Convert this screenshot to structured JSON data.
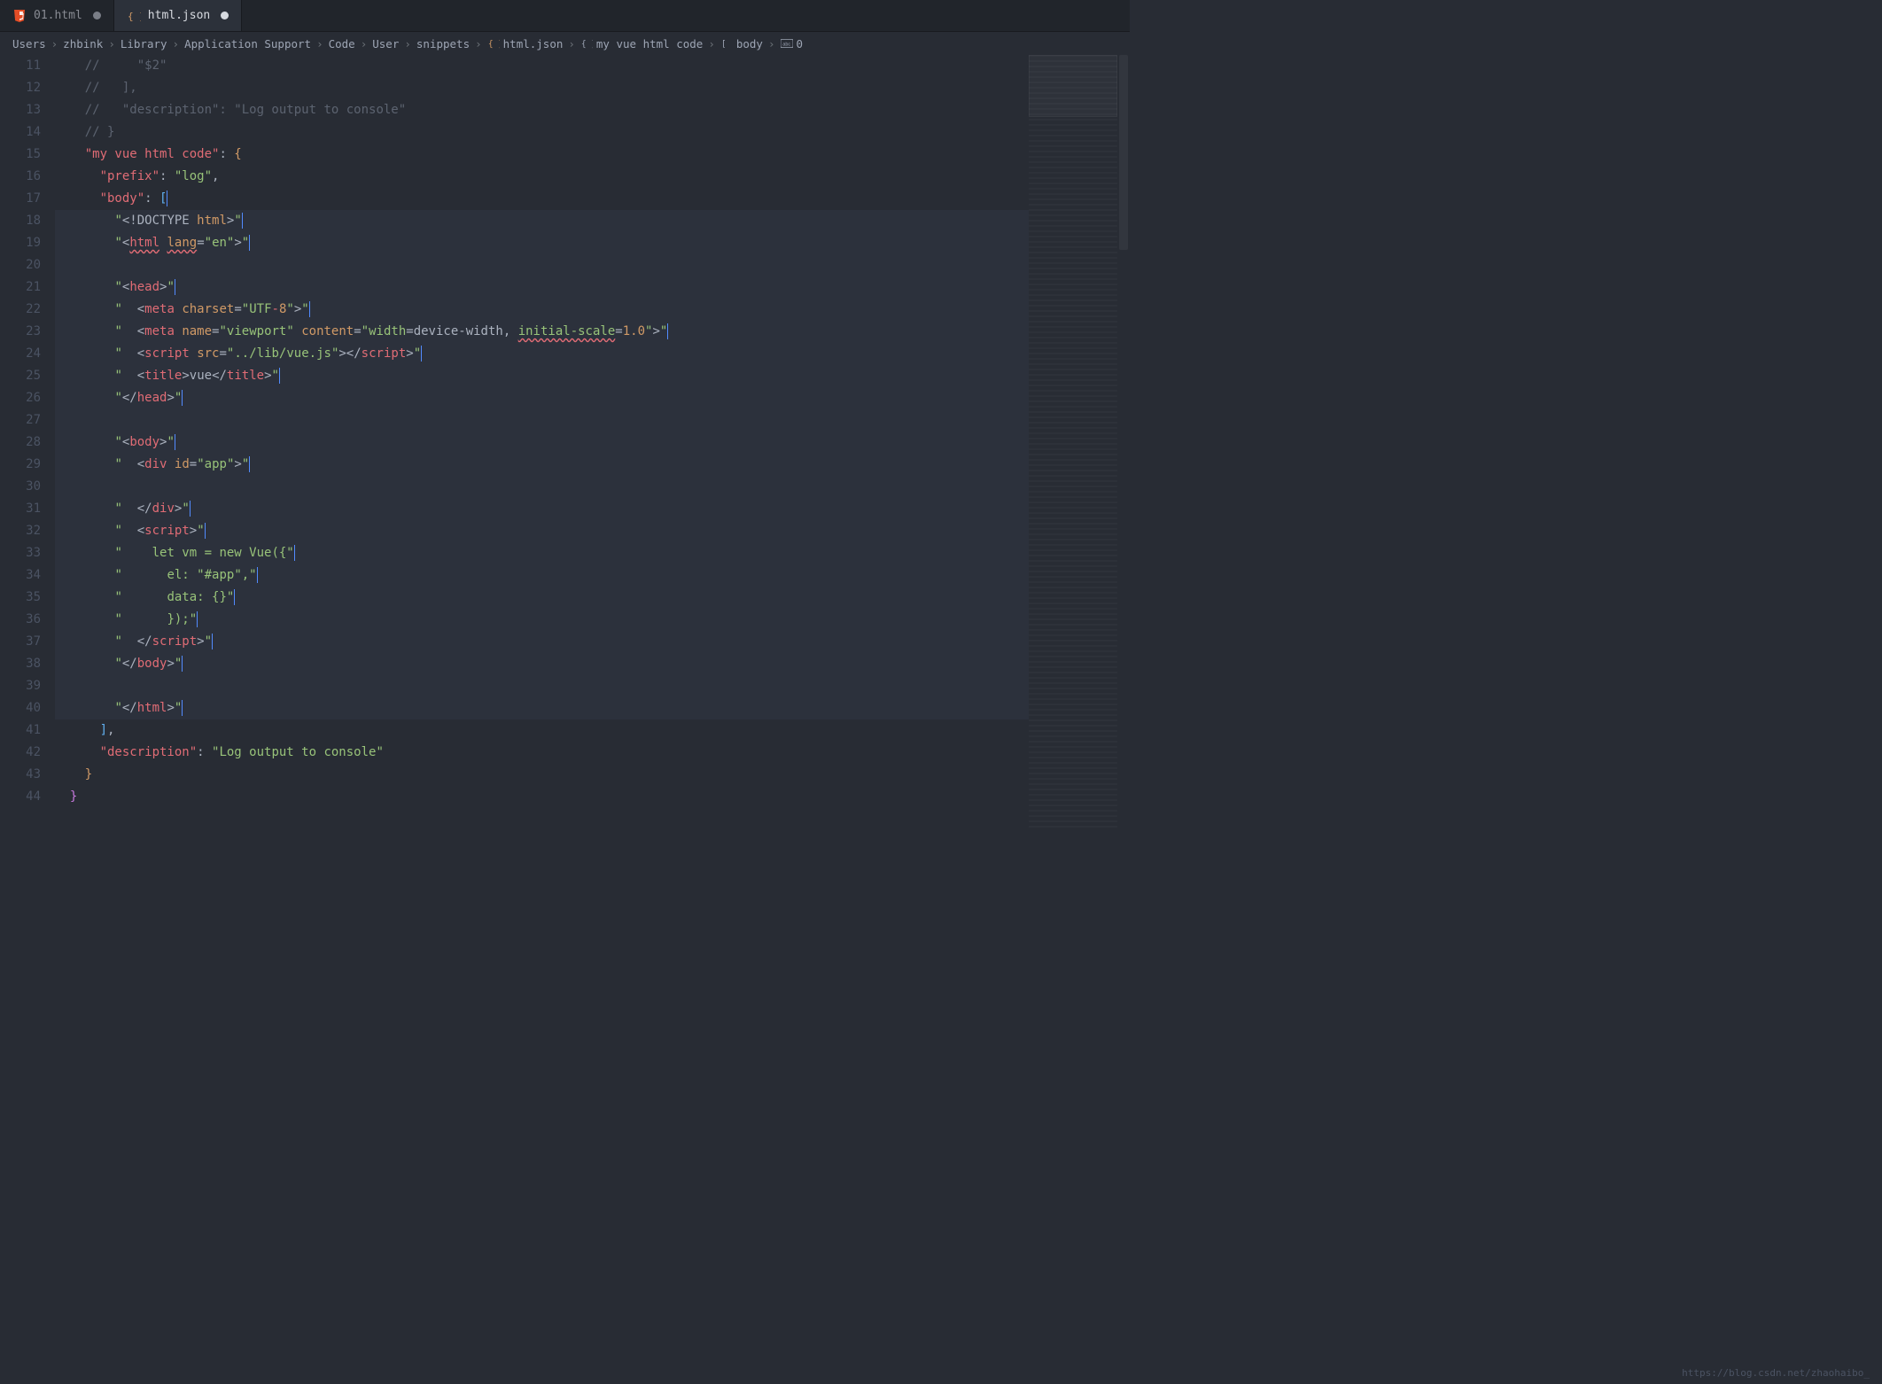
{
  "tabs": [
    {
      "label": "01.html",
      "icon": "html5-icon",
      "dirty": true,
      "active": false
    },
    {
      "label": "html.json",
      "icon": "json-icon",
      "dirty": true,
      "active": true
    }
  ],
  "breadcrumb": [
    {
      "label": "Users"
    },
    {
      "label": "zhbink"
    },
    {
      "label": "Library"
    },
    {
      "label": "Application Support"
    },
    {
      "label": "Code"
    },
    {
      "label": "User"
    },
    {
      "label": "snippets"
    },
    {
      "label": "html.json",
      "icon": "json-icon"
    },
    {
      "label": "my vue html code",
      "icon": "braces-icon"
    },
    {
      "label": "body",
      "icon": "brackets-icon"
    },
    {
      "label": "0",
      "icon": "abc-icon"
    }
  ],
  "line_start": 11,
  "lines": [
    {
      "n": 11,
      "hl": false,
      "tokens": [
        {
          "cls": "c-comment",
          "t": "//     \"$2\""
        }
      ],
      "indent": 2
    },
    {
      "n": 12,
      "hl": false,
      "tokens": [
        {
          "cls": "c-comment",
          "t": "//   ],"
        }
      ],
      "indent": 2
    },
    {
      "n": 13,
      "hl": false,
      "tokens": [
        {
          "cls": "c-comment",
          "t": "//   \"description\": \"Log output to console\""
        }
      ],
      "indent": 2
    },
    {
      "n": 14,
      "hl": false,
      "tokens": [
        {
          "cls": "c-comment",
          "t": "// }"
        }
      ],
      "indent": 2
    },
    {
      "n": 15,
      "hl": false,
      "tokens": [
        {
          "cls": "c-key",
          "t": "\"my vue html code\""
        },
        {
          "cls": "c-punct",
          "t": ": "
        },
        {
          "cls": "c-brace",
          "t": "{"
        }
      ],
      "indent": 2
    },
    {
      "n": 16,
      "hl": false,
      "tokens": [
        {
          "cls": "c-key",
          "t": "\"prefix\""
        },
        {
          "cls": "c-punct",
          "t": ": "
        },
        {
          "cls": "c-string",
          "t": "\"log\""
        },
        {
          "cls": "c-punct",
          "t": ","
        }
      ],
      "indent": 3
    },
    {
      "n": 17,
      "hl": false,
      "tokens": [
        {
          "cls": "c-key",
          "t": "\"body\""
        },
        {
          "cls": "c-punct",
          "t": ": "
        },
        {
          "cls": "c-bracket",
          "t": "["
        }
      ],
      "indent": 3,
      "cursor_after": true
    },
    {
      "n": 18,
      "hl": true,
      "tokens": [
        {
          "cls": "c-string",
          "t": "\""
        },
        {
          "cls": "c-tagpunc",
          "t": "<!DOCTYPE "
        },
        {
          "cls": "c-attr",
          "t": "html"
        },
        {
          "cls": "c-tagpunc",
          "t": ">"
        },
        {
          "cls": "c-string",
          "t": "\""
        }
      ],
      "indent": 4,
      "caret": true
    },
    {
      "n": 19,
      "hl": true,
      "tokens": [
        {
          "cls": "c-string",
          "t": "\""
        },
        {
          "cls": "c-tagpunc",
          "t": "<"
        },
        {
          "cls": "c-tagname squiggle",
          "t": "html"
        },
        {
          "cls": "c-inner",
          "t": " "
        },
        {
          "cls": "c-attr squiggle",
          "t": "lang"
        },
        {
          "cls": "c-tagpunc",
          "t": "="
        },
        {
          "cls": "c-string",
          "t": "\""
        },
        {
          "cls": "c-attrval",
          "t": "en"
        },
        {
          "cls": "c-string",
          "t": "\""
        },
        {
          "cls": "c-tagpunc",
          "t": ">"
        },
        {
          "cls": "c-string",
          "t": "\""
        }
      ],
      "indent": 4,
      "caret": true
    },
    {
      "n": 20,
      "hl": true,
      "tokens": [],
      "indent": 0
    },
    {
      "n": 21,
      "hl": true,
      "tokens": [
        {
          "cls": "c-string",
          "t": "\""
        },
        {
          "cls": "c-tagpunc",
          "t": "<"
        },
        {
          "cls": "c-tagname",
          "t": "head"
        },
        {
          "cls": "c-tagpunc",
          "t": ">"
        },
        {
          "cls": "c-string",
          "t": "\""
        }
      ],
      "indent": 4,
      "caret": true
    },
    {
      "n": 22,
      "hl": true,
      "tokens": [
        {
          "cls": "c-string",
          "t": "\"  "
        },
        {
          "cls": "c-tagpunc",
          "t": "<"
        },
        {
          "cls": "c-tagname",
          "t": "meta"
        },
        {
          "cls": "c-inner",
          "t": " "
        },
        {
          "cls": "c-attr",
          "t": "charset"
        },
        {
          "cls": "c-tagpunc",
          "t": "="
        },
        {
          "cls": "c-string",
          "t": "\""
        },
        {
          "cls": "c-attrval",
          "t": "UTF"
        },
        {
          "cls": "c-tagname",
          "t": "-"
        },
        {
          "cls": "c-num",
          "t": "8"
        },
        {
          "cls": "c-string",
          "t": "\""
        },
        {
          "cls": "c-tagpunc",
          "t": ">"
        },
        {
          "cls": "c-string",
          "t": "\""
        }
      ],
      "indent": 4,
      "caret": true
    },
    {
      "n": 23,
      "hl": true,
      "tokens": [
        {
          "cls": "c-string",
          "t": "\"  "
        },
        {
          "cls": "c-tagpunc",
          "t": "<"
        },
        {
          "cls": "c-tagname",
          "t": "meta"
        },
        {
          "cls": "c-inner",
          "t": " "
        },
        {
          "cls": "c-attr",
          "t": "name"
        },
        {
          "cls": "c-tagpunc",
          "t": "="
        },
        {
          "cls": "c-string",
          "t": "\""
        },
        {
          "cls": "c-attrval",
          "t": "viewport"
        },
        {
          "cls": "c-string",
          "t": "\" "
        },
        {
          "cls": "c-attr",
          "t": "content"
        },
        {
          "cls": "c-tagpunc",
          "t": "="
        },
        {
          "cls": "c-string",
          "t": "\""
        },
        {
          "cls": "c-attrval",
          "t": "width"
        },
        {
          "cls": "c-inner",
          "t": "=device-width, "
        },
        {
          "cls": "c-attrval squiggle",
          "t": "initial-scale"
        },
        {
          "cls": "c-inner",
          "t": "="
        },
        {
          "cls": "c-num",
          "t": "1.0"
        },
        {
          "cls": "c-string",
          "t": "\""
        },
        {
          "cls": "c-tagpunc",
          "t": ">"
        },
        {
          "cls": "c-string",
          "t": "\""
        }
      ],
      "indent": 4,
      "caret": true
    },
    {
      "n": 24,
      "hl": true,
      "tokens": [
        {
          "cls": "c-string",
          "t": "\"  "
        },
        {
          "cls": "c-tagpunc",
          "t": "<"
        },
        {
          "cls": "c-tagname",
          "t": "script"
        },
        {
          "cls": "c-inner",
          "t": " "
        },
        {
          "cls": "c-attr",
          "t": "src"
        },
        {
          "cls": "c-tagpunc",
          "t": "="
        },
        {
          "cls": "c-string",
          "t": "\""
        },
        {
          "cls": "c-attrval",
          "t": "../lib/vue.js"
        },
        {
          "cls": "c-string",
          "t": "\""
        },
        {
          "cls": "c-tagpunc",
          "t": "></"
        },
        {
          "cls": "c-tagname",
          "t": "script"
        },
        {
          "cls": "c-tagpunc",
          "t": ">"
        },
        {
          "cls": "c-string",
          "t": "\""
        }
      ],
      "indent": 4,
      "caret": true
    },
    {
      "n": 25,
      "hl": true,
      "tokens": [
        {
          "cls": "c-string",
          "t": "\"  "
        },
        {
          "cls": "c-tagpunc",
          "t": "<"
        },
        {
          "cls": "c-tagname",
          "t": "title"
        },
        {
          "cls": "c-tagpunc",
          "t": ">"
        },
        {
          "cls": "c-inner",
          "t": "vue"
        },
        {
          "cls": "c-tagpunc",
          "t": "</"
        },
        {
          "cls": "c-tagname",
          "t": "title"
        },
        {
          "cls": "c-tagpunc",
          "t": ">"
        },
        {
          "cls": "c-string",
          "t": "\""
        }
      ],
      "indent": 4,
      "caret": true
    },
    {
      "n": 26,
      "hl": true,
      "tokens": [
        {
          "cls": "c-string",
          "t": "\""
        },
        {
          "cls": "c-tagpunc",
          "t": "</"
        },
        {
          "cls": "c-tagname",
          "t": "head"
        },
        {
          "cls": "c-tagpunc",
          "t": ">"
        },
        {
          "cls": "c-string",
          "t": "\""
        }
      ],
      "indent": 4,
      "caret": true
    },
    {
      "n": 27,
      "hl": true,
      "tokens": [],
      "indent": 0
    },
    {
      "n": 28,
      "hl": true,
      "tokens": [
        {
          "cls": "c-string",
          "t": "\""
        },
        {
          "cls": "c-tagpunc",
          "t": "<"
        },
        {
          "cls": "c-tagname",
          "t": "body"
        },
        {
          "cls": "c-tagpunc",
          "t": ">"
        },
        {
          "cls": "c-string",
          "t": "\""
        }
      ],
      "indent": 4,
      "caret": true
    },
    {
      "n": 29,
      "hl": true,
      "tokens": [
        {
          "cls": "c-string",
          "t": "\"  "
        },
        {
          "cls": "c-tagpunc",
          "t": "<"
        },
        {
          "cls": "c-tagname",
          "t": "div"
        },
        {
          "cls": "c-inner",
          "t": " "
        },
        {
          "cls": "c-attr",
          "t": "id"
        },
        {
          "cls": "c-tagpunc",
          "t": "="
        },
        {
          "cls": "c-string",
          "t": "\""
        },
        {
          "cls": "c-attrval",
          "t": "app"
        },
        {
          "cls": "c-string",
          "t": "\""
        },
        {
          "cls": "c-tagpunc",
          "t": ">"
        },
        {
          "cls": "c-string",
          "t": "\""
        }
      ],
      "indent": 4,
      "caret": true
    },
    {
      "n": 30,
      "hl": true,
      "tokens": [],
      "indent": 0
    },
    {
      "n": 31,
      "hl": true,
      "tokens": [
        {
          "cls": "c-string",
          "t": "\"  "
        },
        {
          "cls": "c-tagpunc",
          "t": "</"
        },
        {
          "cls": "c-tagname",
          "t": "div"
        },
        {
          "cls": "c-tagpunc",
          "t": ">"
        },
        {
          "cls": "c-string",
          "t": "\""
        }
      ],
      "indent": 4,
      "caret": true
    },
    {
      "n": 32,
      "hl": true,
      "tokens": [
        {
          "cls": "c-string",
          "t": "\"  "
        },
        {
          "cls": "c-tagpunc",
          "t": "<"
        },
        {
          "cls": "c-tagname",
          "t": "script"
        },
        {
          "cls": "c-tagpunc",
          "t": ">"
        },
        {
          "cls": "c-string",
          "t": "\""
        }
      ],
      "indent": 4,
      "caret": true
    },
    {
      "n": 33,
      "hl": true,
      "tokens": [
        {
          "cls": "c-string",
          "t": "\"    let vm = new Vue({\""
        }
      ],
      "indent": 4,
      "caret": true
    },
    {
      "n": 34,
      "hl": true,
      "tokens": [
        {
          "cls": "c-string",
          "t": "\"      el: "
        },
        {
          "cls": "c-string",
          "t": "\""
        },
        {
          "cls": "c-attrval",
          "t": "#app"
        },
        {
          "cls": "c-string",
          "t": "\""
        },
        {
          "cls": "c-string",
          "t": ",\""
        }
      ],
      "indent": 4,
      "caret": true
    },
    {
      "n": 35,
      "hl": true,
      "tokens": [
        {
          "cls": "c-string",
          "t": "\"      data: {}\""
        }
      ],
      "indent": 4,
      "caret": true
    },
    {
      "n": 36,
      "hl": true,
      "tokens": [
        {
          "cls": "c-string",
          "t": "\"      });\""
        }
      ],
      "indent": 4,
      "caret": true
    },
    {
      "n": 37,
      "hl": true,
      "tokens": [
        {
          "cls": "c-string",
          "t": "\"  "
        },
        {
          "cls": "c-tagpunc",
          "t": "</"
        },
        {
          "cls": "c-tagname",
          "t": "script"
        },
        {
          "cls": "c-tagpunc",
          "t": ">"
        },
        {
          "cls": "c-string",
          "t": "\""
        }
      ],
      "indent": 4,
      "caret": true
    },
    {
      "n": 38,
      "hl": true,
      "tokens": [
        {
          "cls": "c-string",
          "t": "\""
        },
        {
          "cls": "c-tagpunc",
          "t": "</"
        },
        {
          "cls": "c-tagname",
          "t": "body"
        },
        {
          "cls": "c-tagpunc",
          "t": ">"
        },
        {
          "cls": "c-string",
          "t": "\""
        }
      ],
      "indent": 4,
      "caret": true
    },
    {
      "n": 39,
      "hl": true,
      "tokens": [],
      "indent": 0
    },
    {
      "n": 40,
      "hl": true,
      "tokens": [
        {
          "cls": "c-string",
          "t": "\""
        },
        {
          "cls": "c-tagpunc",
          "t": "</"
        },
        {
          "cls": "c-tagname",
          "t": "html"
        },
        {
          "cls": "c-tagpunc",
          "t": ">"
        },
        {
          "cls": "c-string",
          "t": "\""
        }
      ],
      "indent": 4,
      "caret": true
    },
    {
      "n": 41,
      "hl": false,
      "tokens": [
        {
          "cls": "c-bracket",
          "t": "]"
        },
        {
          "cls": "c-punct",
          "t": ","
        }
      ],
      "indent": 3
    },
    {
      "n": 42,
      "hl": false,
      "tokens": [
        {
          "cls": "c-key",
          "t": "\"description\""
        },
        {
          "cls": "c-punct",
          "t": ": "
        },
        {
          "cls": "c-string",
          "t": "\"Log output to console\""
        }
      ],
      "indent": 3
    },
    {
      "n": 43,
      "hl": false,
      "tokens": [
        {
          "cls": "c-brace",
          "t": "}"
        }
      ],
      "indent": 2
    },
    {
      "n": 44,
      "hl": false,
      "tokens": [
        {
          "cls": "c-bracket2",
          "t": "}"
        }
      ],
      "indent": 1
    }
  ],
  "watermark": "https://blog.csdn.net/zhaohaibo_"
}
